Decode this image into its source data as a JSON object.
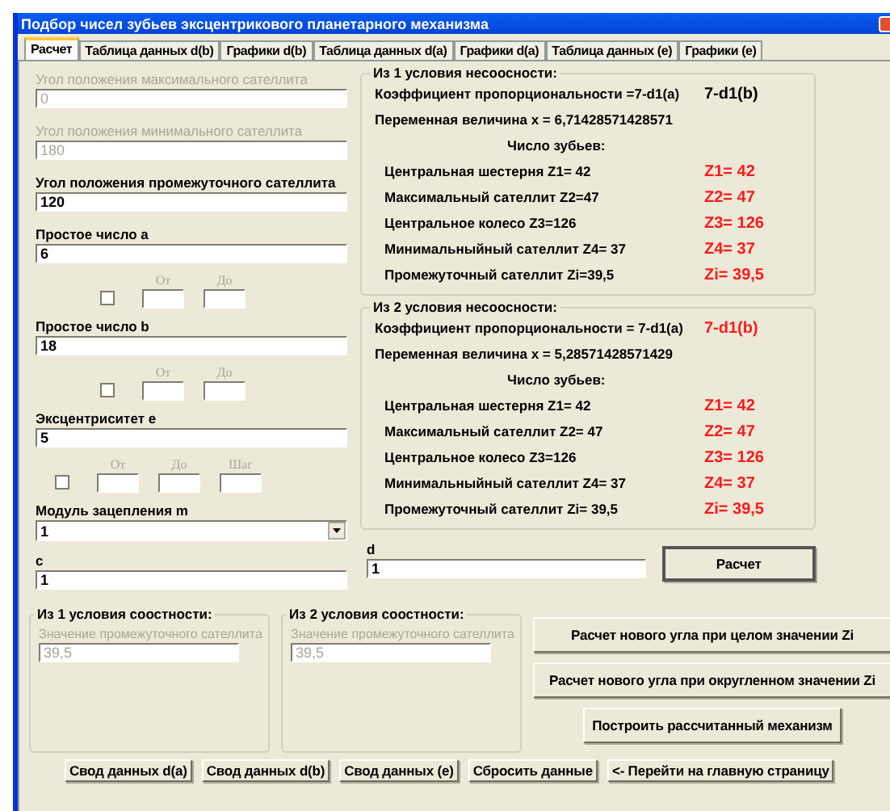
{
  "window": {
    "title": "Подбор чисел зубьев эксцентрикового планетарного механизма"
  },
  "tabs": [
    {
      "label": "Расчет",
      "selected": true
    },
    {
      "label": "Таблица данных d(b)",
      "selected": false
    },
    {
      "label": "Графики d(b)",
      "selected": false
    },
    {
      "label": "Таблица данных d(a)",
      "selected": false
    },
    {
      "label": "Графики d(a)",
      "selected": false
    },
    {
      "label": "Таблица данных (e)",
      "selected": false
    },
    {
      "label": "Графики (e)",
      "selected": false
    }
  ],
  "left_fields": [
    {
      "kind": "field",
      "label": "Угол положения максимального сателлита",
      "value": "0",
      "disabled": true
    },
    {
      "kind": "field",
      "label": "Угол положения минимального сателлита",
      "value": "180",
      "disabled": true
    },
    {
      "kind": "field",
      "label": "Угол положения промежуточного сателлита",
      "value": "120",
      "disabled": false
    },
    {
      "kind": "field",
      "label": "Простое число a",
      "value": "6",
      "disabled": false
    },
    {
      "kind": "range",
      "checked": false,
      "columns": [
        "От",
        "До"
      ]
    },
    {
      "kind": "field",
      "label": "Простое число b",
      "value": "18",
      "disabled": false
    },
    {
      "kind": "range",
      "checked": false,
      "columns": [
        "От",
        "До"
      ]
    },
    {
      "kind": "field",
      "label": "Эксцентриситет e",
      "value": "5",
      "disabled": false
    },
    {
      "kind": "range",
      "checked": false,
      "columns": [
        "От",
        "До",
        "Шаг"
      ]
    },
    {
      "kind": "select",
      "label": "Модуль зацепления m",
      "value": "1"
    },
    {
      "kind": "field",
      "label": "c",
      "value": "1",
      "disabled": false
    }
  ],
  "condition_groups": [
    {
      "title": "Из 1 условия несоосности:",
      "coefficient_label": "Коэффициент пропорциональности =7-d1(a)",
      "coefficient_value": "7-d1(b)",
      "coefficient_highlight": false,
      "variable": "Переменная величина x = 6,71428571428571",
      "teeth_heading": "Число зубьев:",
      "rows": [
        {
          "label": "Центральная шестерня Z1= 42",
          "value": "Z1=  42"
        },
        {
          "label": "Максимальный сателлит Z2=47",
          "value": "Z2=  47"
        },
        {
          "label": "Центральное колесо Z3=126",
          "value": "Z3=  126"
        },
        {
          "label": "Минимальныйный сателлит Z4= 37",
          "value": "Z4=  37"
        },
        {
          "label": "Промежуточный сателлит Zi=39,5",
          "value": "Zi=  39,5"
        }
      ]
    },
    {
      "title": "Из 2 условия несоосности:",
      "coefficient_label": "Коэффициент пропорциональности = 7-d1(a)",
      "coefficient_value": "7-d1(b)",
      "coefficient_highlight": true,
      "variable": "Переменная величина x =  5,28571428571429",
      "teeth_heading": "Число зубьев:",
      "rows": [
        {
          "label": "Центральная шестерня Z1= 42",
          "value": "Z1=  42"
        },
        {
          "label": "Максимальный сателлит Z2= 47",
          "value": "Z2=  47"
        },
        {
          "label": "Центральное колесо Z3=126",
          "value": "Z3=  126"
        },
        {
          "label": "Минимальныйный сателлит Z4= 37",
          "value": "Z4=  37"
        },
        {
          "label": "Промежуточный сателлит Zi= 39,5",
          "value": "Zi=  39,5"
        }
      ]
    }
  ],
  "d_field": {
    "label": "d",
    "value": "1"
  },
  "calculate_button": "Расчет",
  "coaxial_groups": [
    {
      "title": "Из 1 условия соостности:",
      "field_label": "Значение промежуточного сателлита",
      "value": "39,5"
    },
    {
      "title": "Из 2 условия соостности:",
      "field_label": "Значение промежуточного сателлита",
      "value": "39,5"
    }
  ],
  "action_buttons": [
    "Расчет нового угла при целом значении Zi",
    "Расчет нового угла при округленном значении Zi",
    "Построить рассчитанный механизм"
  ],
  "footer_buttons": [
    "Свод данных d(a)",
    "Свод данных d(b)",
    "Свод данных (e)",
    "Сбросить данные",
    "<- Перейти на главную страницу"
  ]
}
